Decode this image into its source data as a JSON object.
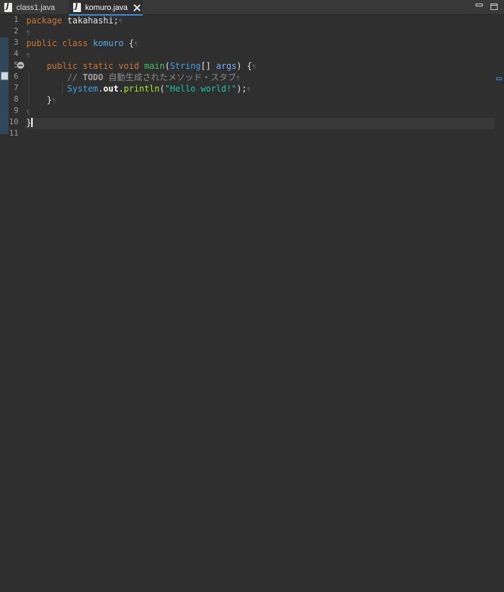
{
  "tabs": [
    {
      "label": "class1.java",
      "icon": "java-file-icon",
      "active": false
    },
    {
      "label": "komuro.java",
      "icon": "java-file-icon",
      "active": true
    }
  ],
  "icon_glyph": "J",
  "line_numbers": [
    "1",
    "2",
    "3",
    "4",
    "5",
    "6",
    "7",
    "8",
    "9",
    "10",
    "11"
  ],
  "code": {
    "l1_kw": "package",
    "l1_rest": " takahashi;",
    "l3_kw": "public class",
    "l3_name": "komuro",
    "l3_brace": " {",
    "l5_kw": "public static void",
    "l5_method": "main",
    "l5_type": "String",
    "l5_param": "args",
    "l6_comment_start": "// ",
    "l6_todo": "TODO",
    "l6_comment_rest": " 自動生成されたメソッド・スタブ",
    "l7_class": "System",
    "l7_field": "out",
    "l7_call": "println",
    "l7_string": "\"Hello world!\"",
    "l8_brace": "}",
    "l10_brace": "}"
  },
  "colors": {
    "background": "#2f2f2f",
    "keyword": "#cc7832",
    "string": "#17c6a3",
    "accent": "#3f8ad8"
  }
}
